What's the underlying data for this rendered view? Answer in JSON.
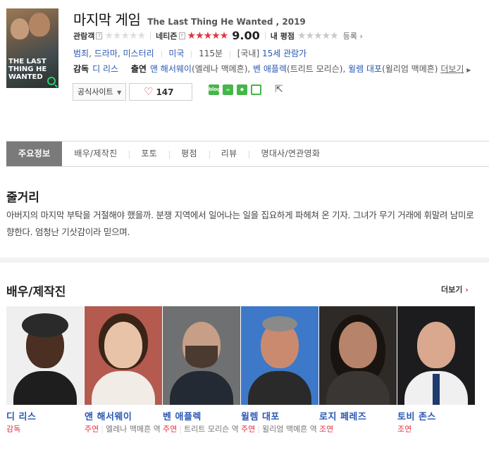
{
  "movie": {
    "title_ko": "마지막 게임",
    "title_en_year": "The Last Thing He Wanted , 2019",
    "poster_text": "THE LAST THING HE WANTED"
  },
  "ratings": {
    "audience_label": "관람객",
    "audience_stars": "★★★★★",
    "netizen_label": "네티즌",
    "netizen_stars": "★★★★★",
    "netizen_score": "9.00",
    "my_label": "내 평점",
    "my_stars": "★★★★★",
    "register": "등록",
    "help_glyph": "?"
  },
  "info": {
    "genres": [
      "범죄",
      "드라마",
      "미스터리"
    ],
    "country": "미국",
    "runtime": "115분",
    "rating_prefix": "[국내]",
    "rating": "15세 관람가"
  },
  "credits": {
    "director_label": "감독",
    "director": "디 리스",
    "cast_label": "출연",
    "cast": [
      {
        "name": "앤 해서웨이",
        "role": "(엘레나 맥메흔)"
      },
      {
        "name": "벤 애플렉",
        "role": "(트리트 모리슨)"
      },
      {
        "name": "윌렘 대포",
        "role": "(윌리엄 맥메흔)"
      }
    ],
    "more": "더보기"
  },
  "actions": {
    "official_site": "공식사이트",
    "likes": "147",
    "share_icons": [
      "blog",
      "cafe",
      "bookmark",
      "me"
    ]
  },
  "tabs": [
    "주요정보",
    "배우/제작진",
    "포토",
    "평점",
    "리뷰",
    "명대사/연관영화"
  ],
  "synopsis": {
    "heading": "줄거리",
    "text": "아버지의 마지막 부탁을 거절해야 했을까. 분쟁 지역에서 일어나는 일을 집요하게 파헤쳐 온 기자. 그녀가 무기 거래에 휘말려 남미로 향한다. 엄청난 기삿감이라 믿으며."
  },
  "cast_section": {
    "heading": "배우/제작진",
    "more": "더보기",
    "people": [
      {
        "name": "디 리스",
        "role_type": "감독",
        "character": ""
      },
      {
        "name": "앤 해서웨이",
        "role_type": "주연",
        "character": "엘레나 맥메흔 역"
      },
      {
        "name": "벤 애플렉",
        "role_type": "주연",
        "character": "트리트 모리슨 역"
      },
      {
        "name": "윌렘 대포",
        "role_type": "주연",
        "character": "윌리엄 맥메흔 역"
      },
      {
        "name": "로지 페레즈",
        "role_type": "조연",
        "character": ""
      },
      {
        "name": "토비 존스",
        "role_type": "조연",
        "character": ""
      }
    ]
  },
  "colors": {
    "link_blue": "#2a57b3",
    "accent_red": "#e4333d",
    "active_tab_bg": "#7a7a7a",
    "share_green": "#45b649"
  }
}
